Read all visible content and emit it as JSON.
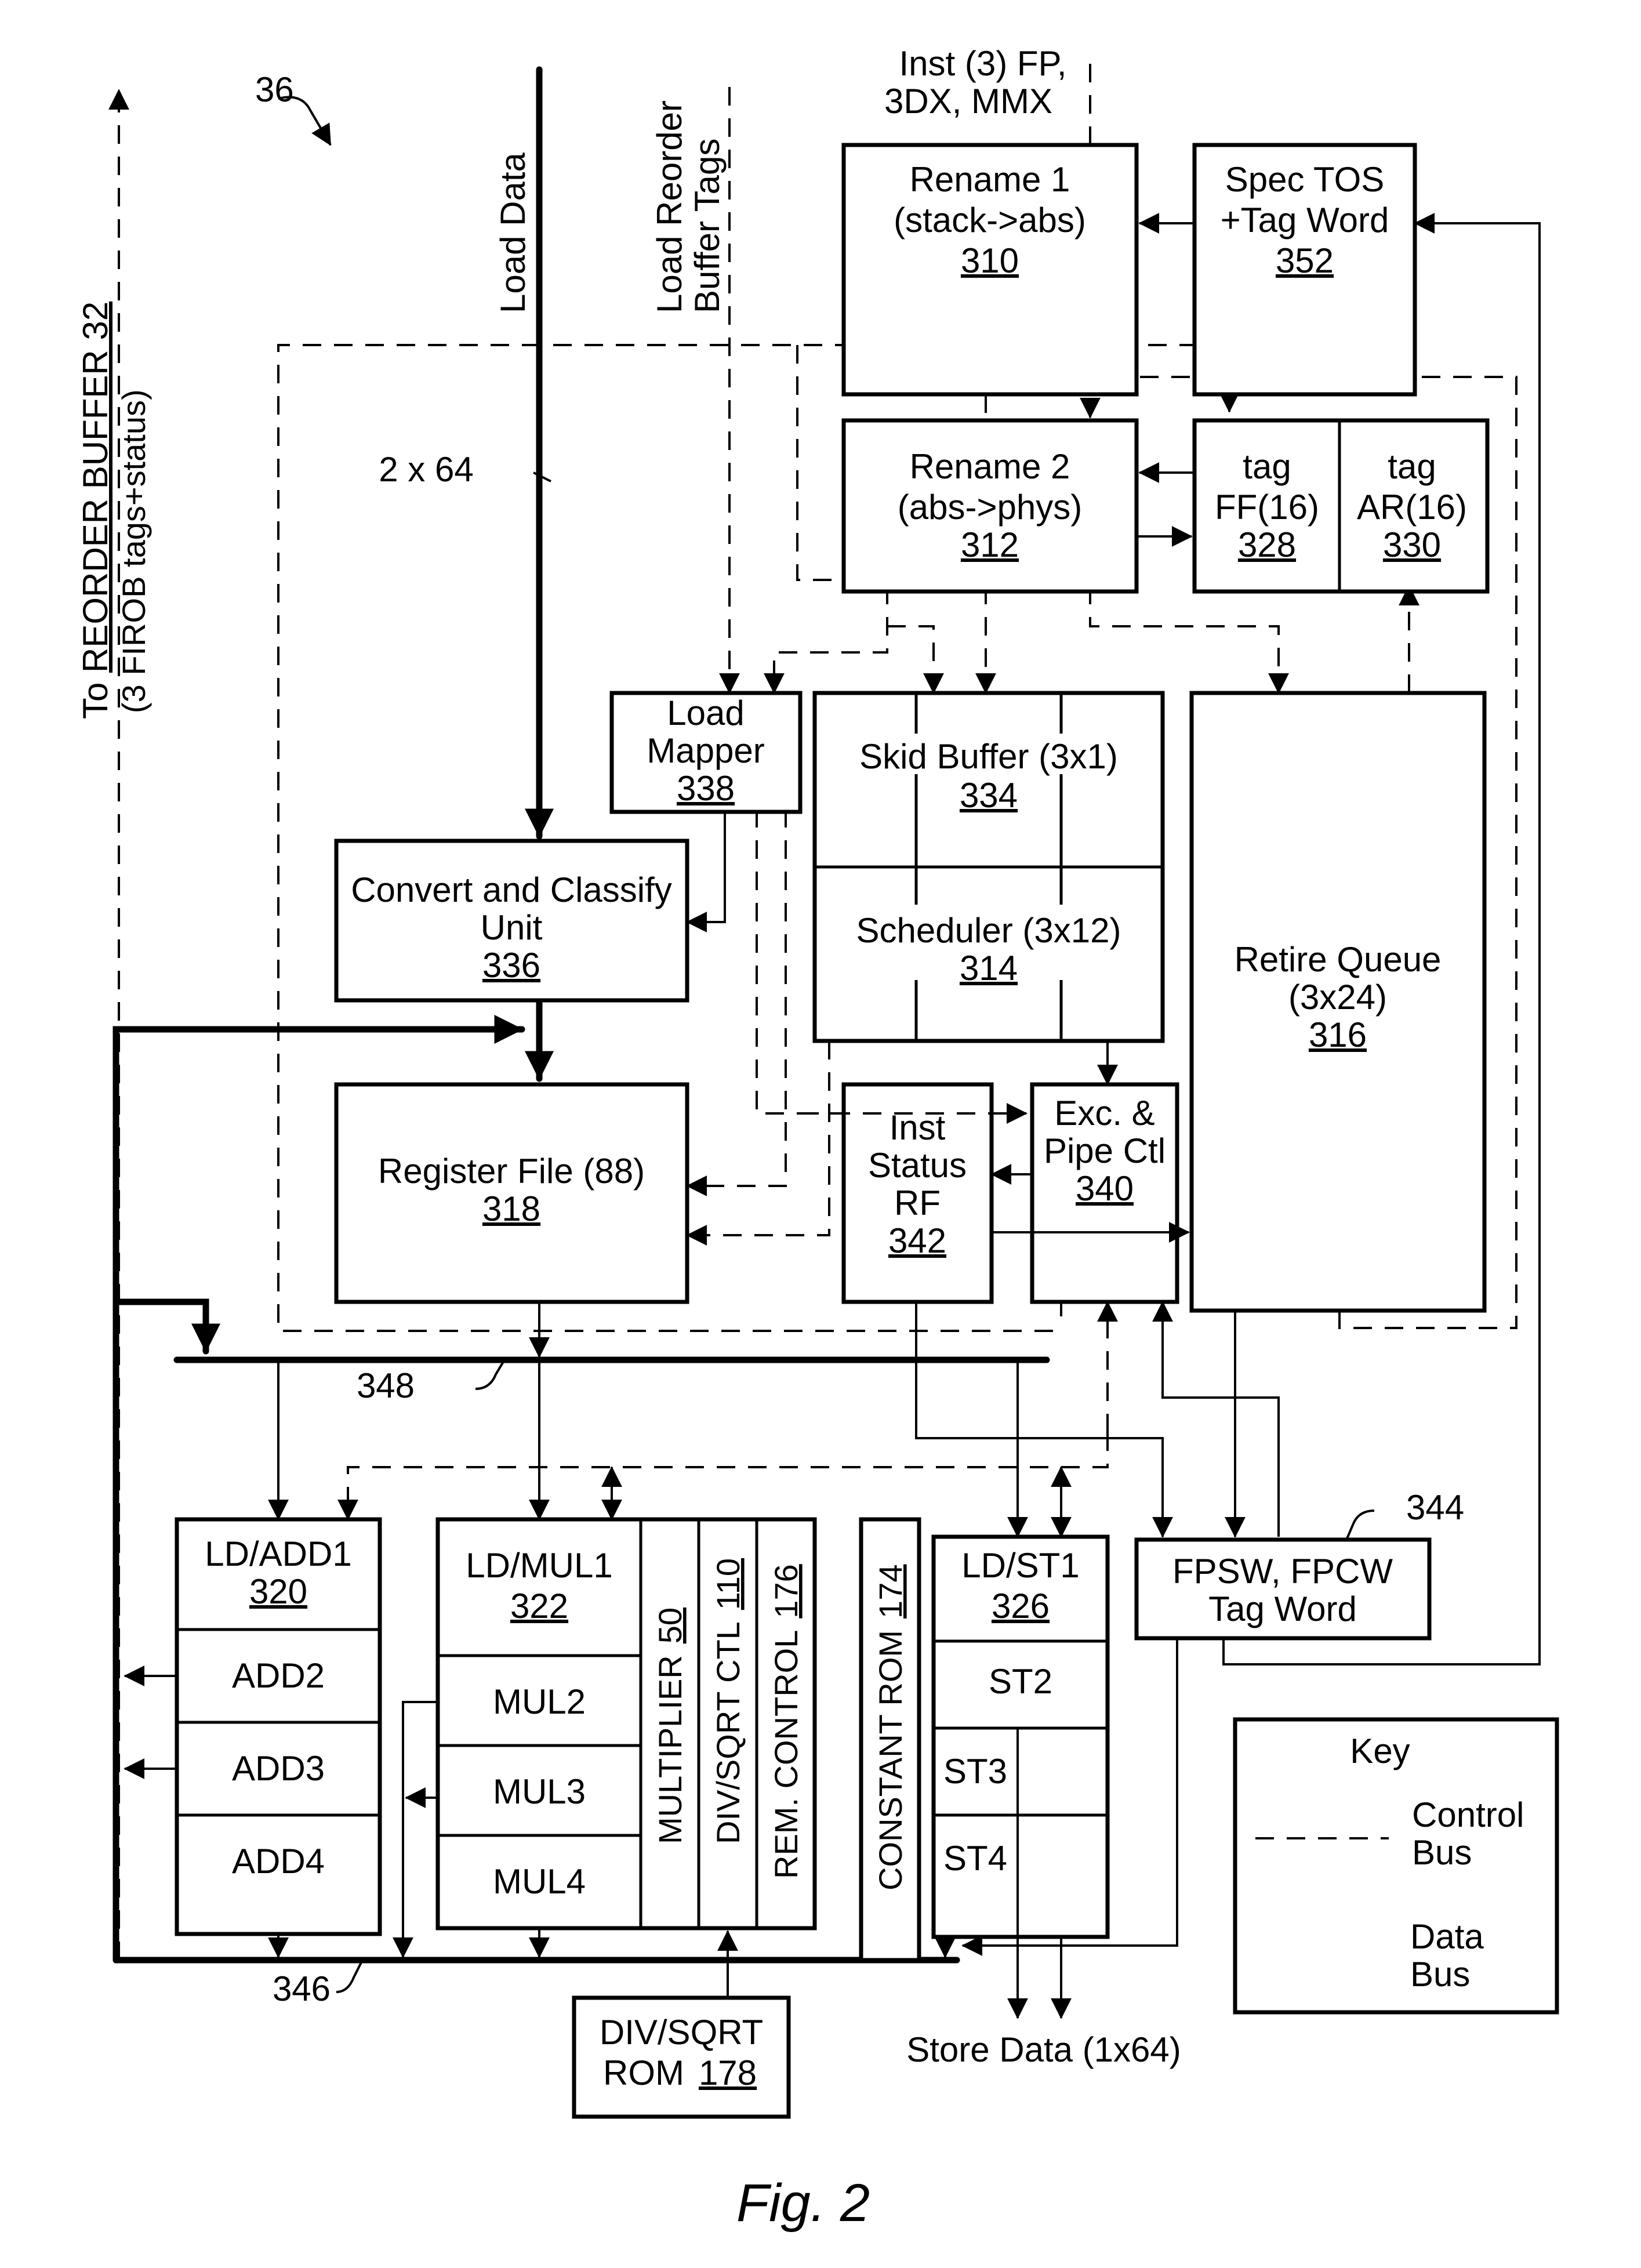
{
  "figure": {
    "number_label": "36",
    "caption": "Fig. 2"
  },
  "inputs": {
    "load_data": "Load Data",
    "load_rob_tags_line1": "Load Reorder",
    "load_rob_tags_line2": "Buffer Tags",
    "inst_line1": "Inst (3) FP,",
    "inst_line2": "3DX, MMX",
    "bus_width": "2 x 64",
    "to_rob_line1_prefix": "To ",
    "to_rob_line1_name": "REORDER BUFFER 32",
    "to_rob_line2": "(3 FIROB tags+status)"
  },
  "blocks": {
    "rename1": {
      "line1": "Rename 1",
      "line2": "(stack->abs)",
      "ref": "310"
    },
    "spec_tos": {
      "line1": "Spec TOS",
      "line2": "+Tag Word",
      "ref": "352"
    },
    "rename2": {
      "line1": "Rename 2",
      "line2": "(abs->phys)",
      "ref": "312"
    },
    "tag_ff": {
      "line1": "tag",
      "line2": "FF(16)",
      "ref": "328"
    },
    "tag_ar": {
      "line1": "tag",
      "line2": "AR(16)",
      "ref": "330"
    },
    "load_mapper": {
      "line1": "Load",
      "line2": "Mapper",
      "ref": "338"
    },
    "skid_buffer": {
      "line1": "Skid Buffer (3x1)",
      "ref": "334"
    },
    "scheduler": {
      "line1": "Scheduler (3x12)",
      "ref": "314"
    },
    "retire_queue": {
      "line1": "Retire Queue",
      "line2": "(3x24)",
      "ref": "316"
    },
    "convert_classify": {
      "line1": "Convert and Classify",
      "line2": "Unit",
      "ref": "336"
    },
    "register_file": {
      "line1": "Register File (88)",
      "ref": "318"
    },
    "inst_status": {
      "line1": "Inst",
      "line2": "Status",
      "line3": "RF",
      "ref": "342"
    },
    "exc_pipe": {
      "line1": "Exc. &",
      "line2": "Pipe Ctl",
      "ref": "340"
    },
    "ld_add": {
      "line1": "LD/ADD1",
      "ref": "320",
      "stages": [
        "ADD2",
        "ADD3",
        "ADD4"
      ]
    },
    "ld_mul": {
      "line1": "LD/MUL1",
      "ref": "322",
      "stages": [
        "MUL2",
        "MUL3",
        "MUL4"
      ]
    },
    "multiplier": {
      "label": "MULTIPLIER",
      "ref": "50"
    },
    "div_sqrt_ctl": {
      "label": "DIV/SQRT CTL",
      "ref": "110"
    },
    "rem_control": {
      "label": "REM. CONTROL",
      "ref": "176"
    },
    "constant_rom": {
      "label": "CONSTANT ROM",
      "ref": "174"
    },
    "ld_st": {
      "line1": "LD/ST1",
      "ref": "326",
      "stages": [
        "ST2",
        "ST3",
        "ST4"
      ]
    },
    "fpsw": {
      "line1": "FPSW, FPCW",
      "line2": "Tag Word",
      "ref": "344"
    },
    "div_sqrt_rom": {
      "line1": "DIV/SQRT",
      "line2": "ROM",
      "ref": "178"
    }
  },
  "buses": {
    "result_bus_ref": "348",
    "writeback_bus_ref": "346",
    "store_data": "Store Data (1x64)"
  },
  "key": {
    "title": "Key",
    "control_line1": "Control",
    "control_line2": "Bus",
    "data_line1": "Data",
    "data_line2": "Bus"
  }
}
